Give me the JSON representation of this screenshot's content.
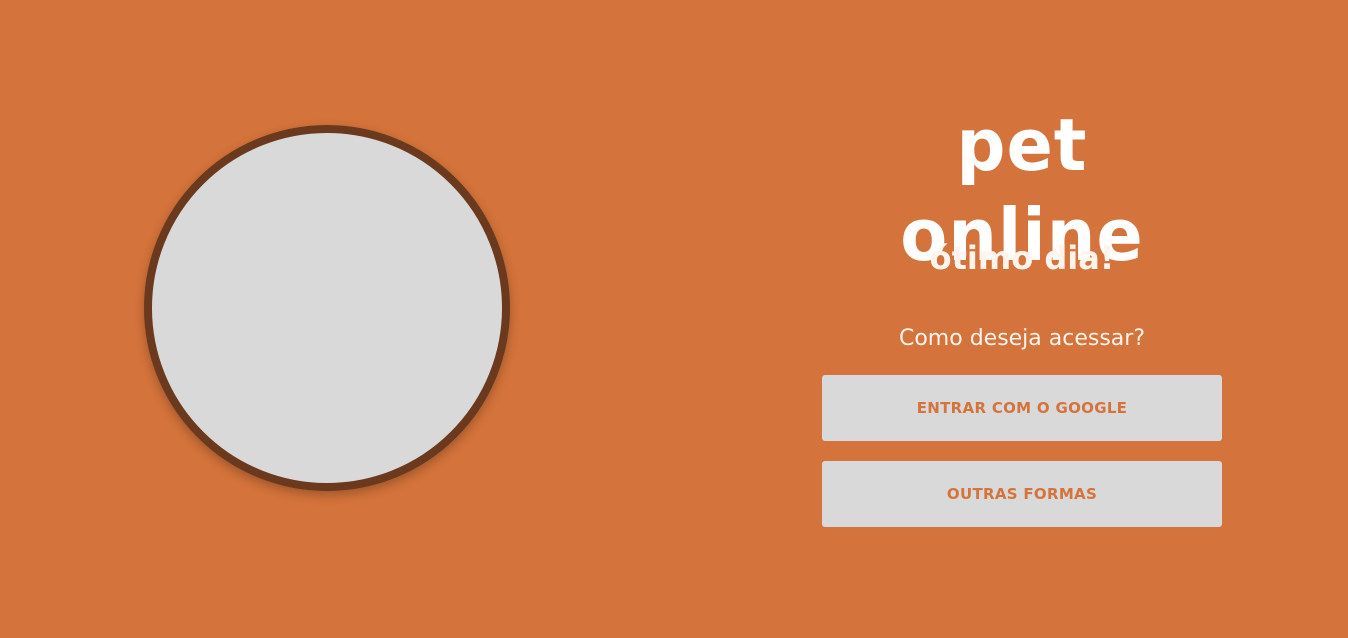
{
  "colors": {
    "background": "#D4733B",
    "circle_fill": "#D9D9D9",
    "circle_border": "#6B3A1E",
    "button_bg": "#D9D9D9",
    "button_text": "#D4733B",
    "text_light": "#FFF4EC"
  },
  "logo": {
    "text": "pet online"
  },
  "greeting": "ótimo dia!",
  "question": "Como deseja acessar?",
  "buttons": {
    "google_label": "ENTRAR COM O GOOGLE",
    "other_label": "OUTRAS FORMAS"
  }
}
